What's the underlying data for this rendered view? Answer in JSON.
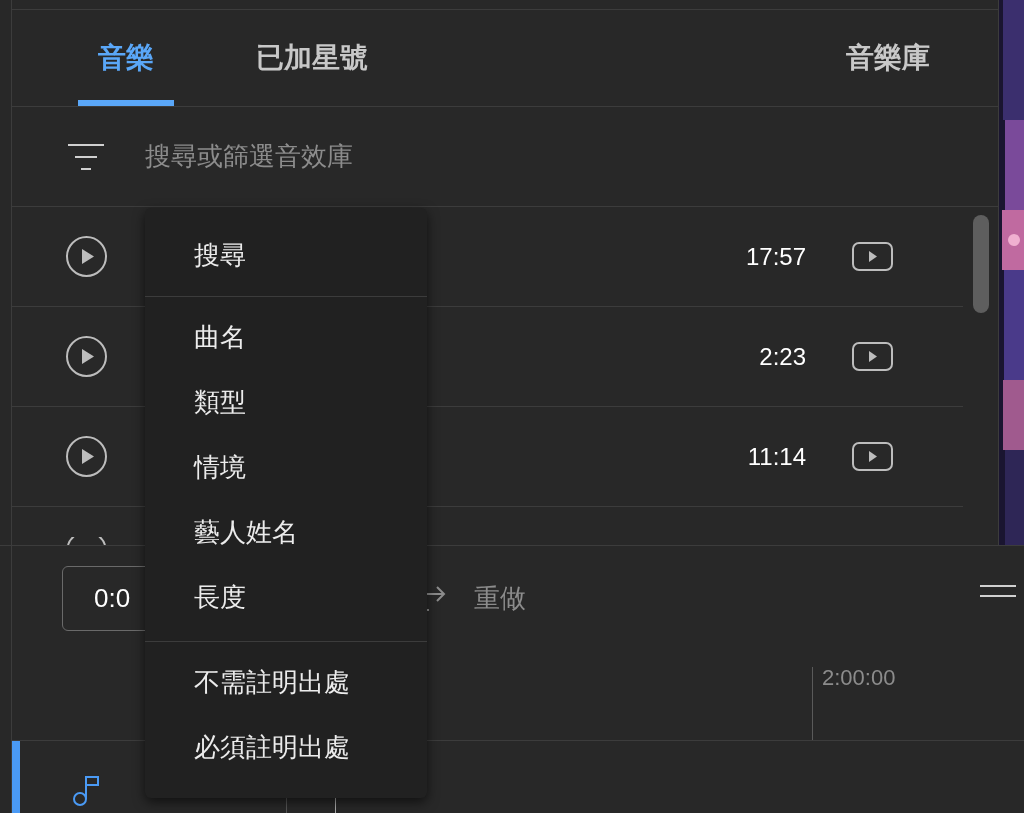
{
  "tabs": [
    {
      "label": "音樂",
      "selected": true
    },
    {
      "label": "已加星號",
      "selected": false
    }
  ],
  "library_link": "音樂庫",
  "search": {
    "placeholder": "搜尋或篩選音效庫"
  },
  "tracks": [
    {
      "duration": "17:57"
    },
    {
      "duration": "2:23"
    },
    {
      "duration": "11:14"
    }
  ],
  "timecode": "0:0",
  "redo": "重做",
  "timeline": {
    "marker": "2:00:00"
  },
  "filter_menu": {
    "sections": [
      {
        "items": [
          "搜尋"
        ]
      },
      {
        "items": [
          "曲名",
          "類型",
          "情境",
          "藝人姓名",
          "長度"
        ]
      },
      {
        "items": [
          "不需註明出處",
          "必須註明出處"
        ]
      }
    ]
  }
}
